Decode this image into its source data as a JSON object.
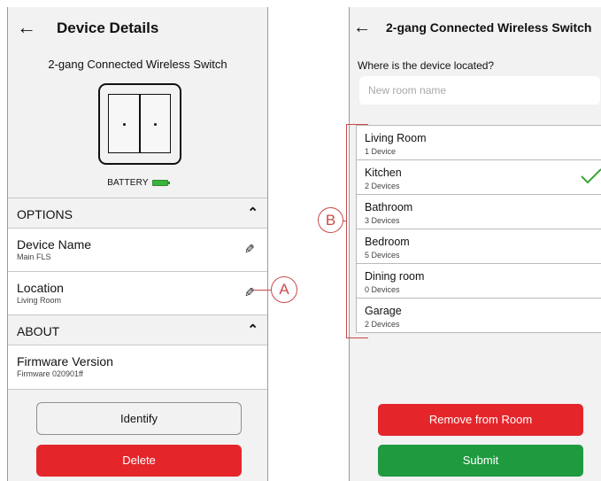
{
  "left_screen": {
    "title": "Device Details",
    "device_name": "2-gang Connected Wireless Switch",
    "battery_label": "BATTERY",
    "options_header": "OPTIONS",
    "device_name_row": {
      "label": "Device Name",
      "value": "Main FLS"
    },
    "location_row": {
      "label": "Location",
      "value": "Living Room"
    },
    "about_header": "ABOUT",
    "firmware_row": {
      "label": "Firmware Version",
      "value": "Firmware 020901ff"
    },
    "identify_button": "Identify",
    "delete_button": "Delete"
  },
  "right_screen": {
    "title": "2-gang Connected Wireless Switch",
    "question": "Where is the device located?",
    "room_input": {
      "value": "",
      "placeholder": "New room name"
    },
    "rooms": [
      {
        "name": "Living Room",
        "count": "1 Device",
        "selected": false
      },
      {
        "name": "Kitchen",
        "count": "2 Devices",
        "selected": true
      },
      {
        "name": "Bathroom",
        "count": "3 Devices",
        "selected": false
      },
      {
        "name": "Bedroom",
        "count": "5 Devices",
        "selected": false
      },
      {
        "name": "Dining room",
        "count": "0 Devices",
        "selected": false
      },
      {
        "name": "Garage",
        "count": "2 Devices",
        "selected": false
      }
    ],
    "remove_button": "Remove from Room",
    "submit_button": "Submit"
  },
  "callouts": {
    "a": "A",
    "b": "B"
  },
  "icons": {
    "back": "arrow-left-icon",
    "collapse": "chevron-up-icon",
    "edit": "pencil-icon",
    "battery": "battery-icon",
    "selected": "checkmark-icon"
  },
  "colors": {
    "delete": "#e4262b",
    "submit": "#1f9a3f",
    "check": "#3aa335",
    "battery": "#3cb43c",
    "callout": "#c94a4a"
  }
}
